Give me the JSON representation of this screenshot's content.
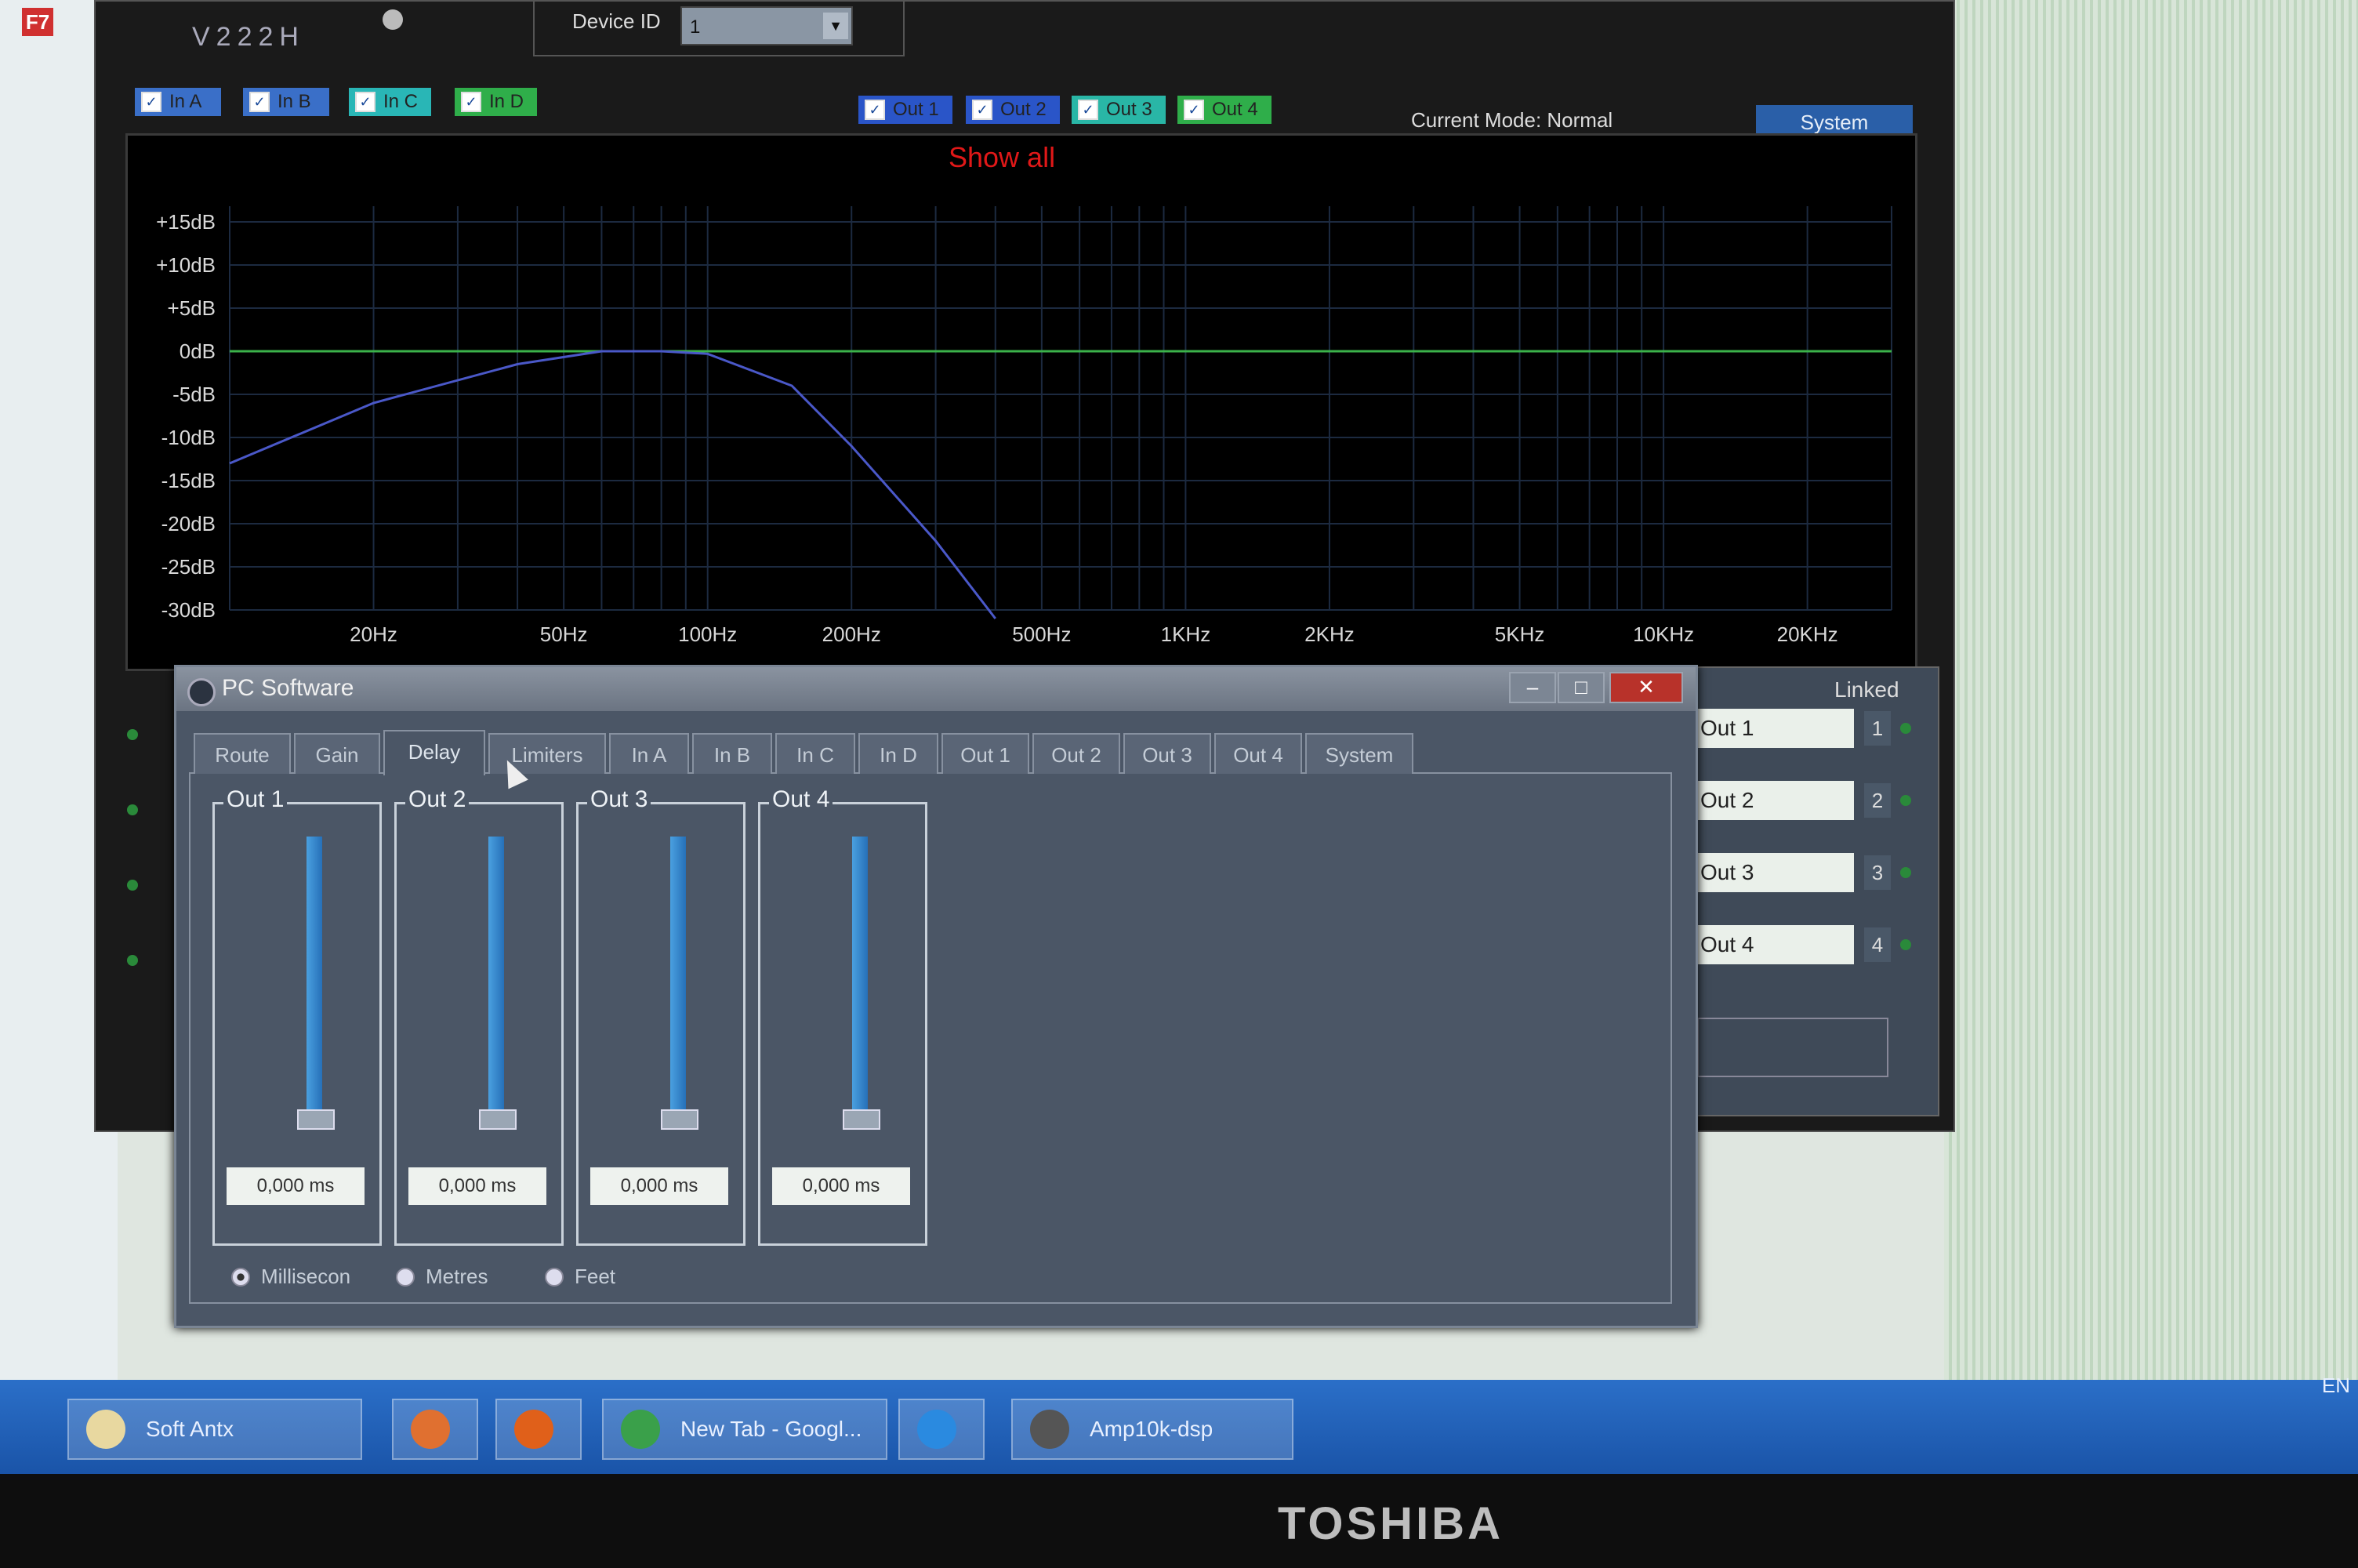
{
  "app": {
    "version": "V222H",
    "device_id_label": "Device ID",
    "device_id_value": "1",
    "input_checks": [
      {
        "label": "In A",
        "color": "#3a6fc8"
      },
      {
        "label": "In B",
        "color": "#3a6fc8"
      },
      {
        "label": "In C",
        "color": "#29b6b6"
      },
      {
        "label": "In D",
        "color": "#2fae4a"
      }
    ],
    "output_checks": [
      {
        "label": "Out 1",
        "color": "#2a55c8"
      },
      {
        "label": "Out 2",
        "color": "#2a55c8"
      },
      {
        "label": "Out 3",
        "color": "#29b6a6"
      },
      {
        "label": "Out 4",
        "color": "#2fae4a"
      }
    ],
    "current_mode": "Current Mode: Normal",
    "system_button": "System",
    "show_all": "Show all"
  },
  "chart_data": {
    "type": "line",
    "y_ticks": [
      "+15dB",
      "+10dB",
      "+5dB",
      "0dB",
      "-5dB",
      "-10dB",
      "-15dB",
      "-20dB",
      "-25dB",
      "-30dB"
    ],
    "x_ticks": [
      "20Hz",
      "50Hz",
      "100Hz",
      "200Hz",
      "500Hz",
      "1KHz",
      "2KHz",
      "5KHz",
      "10KHz",
      "20KHz"
    ],
    "ylim": [
      -30,
      15
    ],
    "xlim_hz": [
      10,
      30000
    ],
    "x_scale": "log",
    "grid": true,
    "series": [
      {
        "color": "#3bb24a",
        "x": [
          10,
          30000
        ],
        "y": [
          0,
          0
        ]
      },
      {
        "color": "#4a58c8",
        "x": [
          10,
          20,
          40,
          60,
          80,
          100,
          150,
          200,
          300,
          400
        ],
        "y": [
          -13,
          -6,
          -1.5,
          0,
          0,
          -0.3,
          -4,
          -11,
          -22,
          -31
        ]
      }
    ]
  },
  "linked_panel": {
    "title": "Linked",
    "items": [
      {
        "label": "Out 1",
        "num": "1"
      },
      {
        "label": "Out 2",
        "num": "2"
      },
      {
        "label": "Out 3",
        "num": "3"
      },
      {
        "label": "Out 4",
        "num": "4"
      }
    ]
  },
  "dialog": {
    "title": "PC Software",
    "minimize": "–",
    "maximize": "□",
    "close": "✕",
    "tabs": [
      "Route",
      "Gain",
      "Delay",
      "Limiters",
      "In A",
      "In B",
      "In C",
      "In D",
      "Out 1",
      "Out 2",
      "Out 3",
      "Out 4",
      "System"
    ],
    "active_tab": "Delay",
    "delay_groups": [
      {
        "label": "Out 1",
        "value": "0,000 ms",
        "level": 0
      },
      {
        "label": "Out 2",
        "value": "0,000 ms",
        "level": 0
      },
      {
        "label": "Out 3",
        "value": "0,000 ms",
        "level": 0
      },
      {
        "label": "Out 4",
        "value": "0,000 ms",
        "level": 0
      }
    ],
    "units": [
      {
        "label": "Millisecon",
        "selected": true
      },
      {
        "label": "Metres",
        "selected": false
      },
      {
        "label": "Feet",
        "selected": false
      }
    ]
  },
  "taskbar": {
    "items": [
      {
        "label": "Soft Antx",
        "icon": "folder-icon"
      },
      {
        "label": "",
        "icon": "media-player-icon"
      },
      {
        "label": "",
        "icon": "firefox-icon"
      },
      {
        "label": "New Tab - Googl...",
        "icon": "chrome-icon"
      },
      {
        "label": "",
        "icon": "internet-explorer-icon"
      },
      {
        "label": "Amp10k-dsp",
        "icon": "amp-dsp-icon"
      }
    ],
    "language": "EN"
  },
  "monitor": {
    "brand": "TOSHIBA"
  }
}
